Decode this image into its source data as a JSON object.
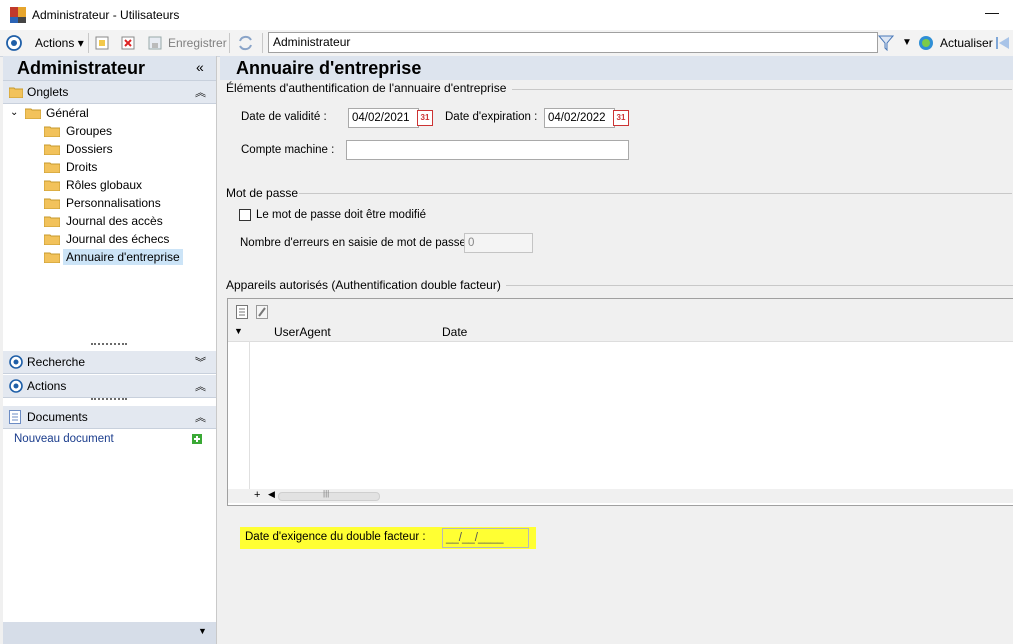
{
  "window": {
    "title": "Administrateur -  Utilisateurs"
  },
  "toolbar": {
    "actions_label": "Actions",
    "save_label": "Enregistrer",
    "search_value": "Administrateur",
    "refresh_label": "Actualiser"
  },
  "left": {
    "title": "Administrateur",
    "onglets_label": "Onglets",
    "tree": {
      "root": "Général",
      "items": [
        "Groupes",
        "Dossiers",
        "Droits",
        "Rôles globaux",
        "Personnalisations",
        "Journal des accès",
        "Journal des échecs",
        "Annuaire d'entreprise"
      ]
    },
    "recherche_label": "Recherche",
    "actions_label": "Actions",
    "documents_label": "Documents",
    "new_document_label": "Nouveau document"
  },
  "main": {
    "title": "Annuaire d'entreprise",
    "auth_group_title": "Éléments d'authentification de l'annuaire d'entreprise",
    "validity_label": "Date de validité :",
    "validity_value": "04/02/2021",
    "expiration_label": "Date d'expiration :",
    "expiration_value": "04/02/2022",
    "machine_label": "Compte machine :",
    "machine_value": "",
    "password_group_title": "Mot de passe",
    "must_change_label": "Le mot de passe doit être modifié",
    "error_count_label": "Nombre d'erreurs en saisie de mot de passe :",
    "error_count_value": "0",
    "devices_group_title": "Appareils autorisés (Authentification double facteur)",
    "grid_columns": [
      "UserAgent",
      "Date"
    ],
    "grid_rows": [],
    "two_factor_label": "Date d'exigence du double facteur :",
    "two_factor_value": "__/__/____"
  },
  "colors": {
    "highlight": "#ffff33",
    "accent": "#1f5fa8"
  }
}
